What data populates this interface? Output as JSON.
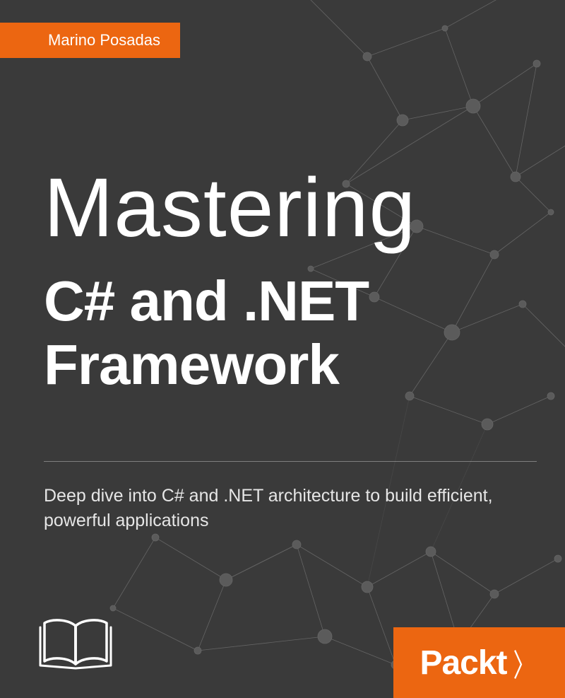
{
  "author": "Marino Posadas",
  "title": {
    "line1": "Mastering",
    "line2": "C# and .NET Framework"
  },
  "subtitle": "Deep dive into C# and .NET architecture to build efficient, powerful applications",
  "publisher": "Packt",
  "colors": {
    "accent": "#ec6611",
    "background": "#3a3a3a"
  }
}
